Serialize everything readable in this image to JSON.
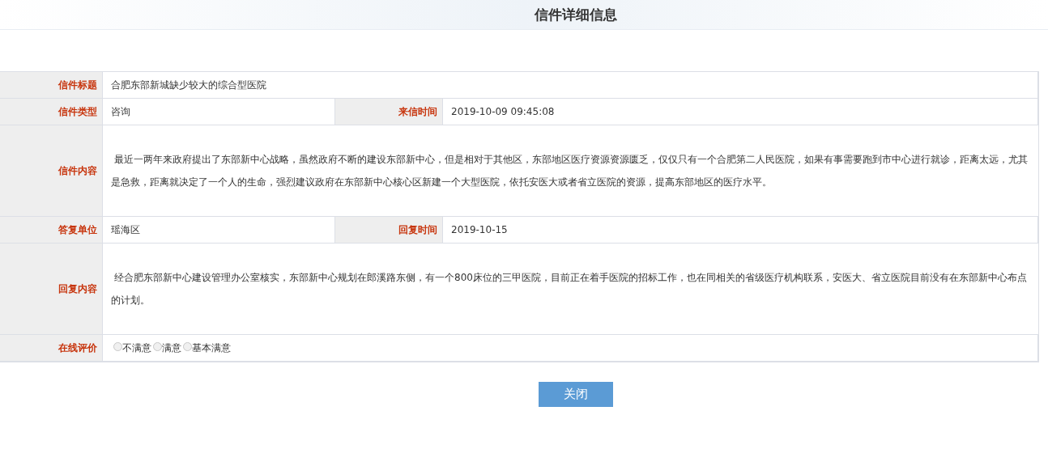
{
  "title": "信件详细信息",
  "rows": [
    {
      "kind": "single",
      "label": "信件标题",
      "value": "合肥东部新城缺少较大的综合型医院"
    },
    {
      "kind": "pair",
      "label": "信件类型",
      "value": "咨询",
      "label_2": "来信时间",
      "value_2": "2019-10-09 09:45:08"
    },
    {
      "kind": "paragraph",
      "label": "信件内容",
      "value": "最近一两年来政府提出了东部新中心战略，虽然政府不断的建设东部新中心，但是相对于其他区，东部地区医疗资源资源匮乏，仅仅只有一个合肥第二人民医院，如果有事需要跑到市中心进行就诊，距离太远，尤其是急救，距离就决定了一个人的生命，强烈建议政府在东部新中心核心区新建一个大型医院，依托安医大或者省立医院的资源，提高东部地区的医疗水平。"
    },
    {
      "kind": "pair",
      "label": "答复单位",
      "value": "瑶海区",
      "label_2": "回复时间",
      "value_2": "2019-10-15"
    },
    {
      "kind": "paragraph",
      "label": "回复内容",
      "value": "经合肥东部新中心建设管理办公室核实，东部新中心规划在郎溪路东侧，有一个800床位的三甲医院，目前正在着手医院的招标工作，也在同相关的省级医疗机构联系，安医大、省立医院目前没有在东部新中心布点的计划。"
    },
    {
      "kind": "rating",
      "label": "在线评价",
      "options": [
        {
          "label": "不满意",
          "selected": false
        },
        {
          "label": "满意",
          "selected": false
        },
        {
          "label": "基本满意",
          "selected": false
        }
      ]
    }
  ],
  "close_button": "关闭"
}
